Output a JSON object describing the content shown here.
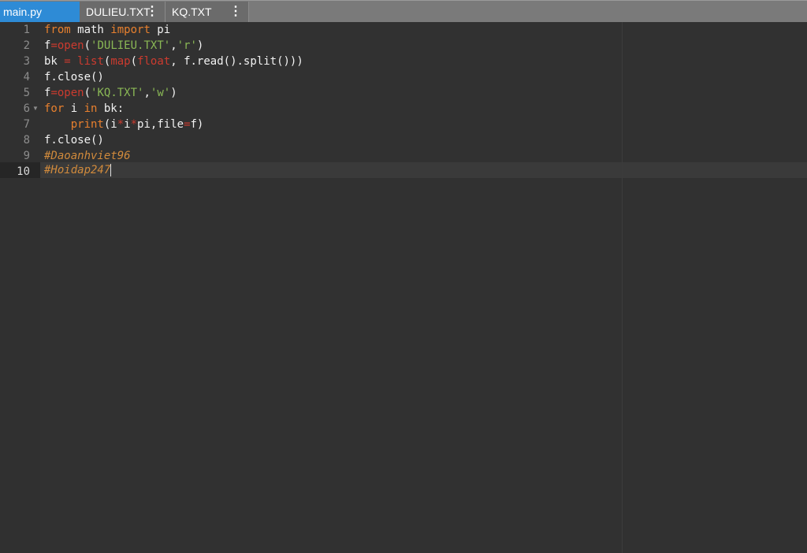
{
  "tabs": [
    {
      "label": "main.py",
      "active": true
    },
    {
      "label": "DULIEU.TXT",
      "active": false,
      "menu_icon": "kebab-menu-icon"
    },
    {
      "label": "KQ.TXT",
      "active": false,
      "menu_icon": "kebab-menu-icon"
    }
  ],
  "line_numbers": [
    "1",
    "2",
    "3",
    "4",
    "5",
    "6",
    "7",
    "8",
    "9",
    "10"
  ],
  "code": {
    "l1": {
      "t1": "from",
      "t2": " math ",
      "t3": "import",
      "t4": " pi"
    },
    "l2": {
      "t1": "f",
      "t2": "=",
      "t3": "open",
      "t4": "(",
      "t5": "'DULIEU.TXT'",
      "t6": ",",
      "t7": "'r'",
      "t8": ")"
    },
    "l3": {
      "t1": "bk ",
      "t2": "=",
      "t3": " ",
      "t4": "list",
      "t5": "(",
      "t6": "map",
      "t7": "(",
      "t8": "float",
      "t9": ", f.read().split()))"
    },
    "l4": {
      "t1": "f.close()"
    },
    "l5": {
      "t1": "f",
      "t2": "=",
      "t3": "open",
      "t4": "(",
      "t5": "'KQ.TXT'",
      "t6": ",",
      "t7": "'w'",
      "t8": ")"
    },
    "l6": {
      "t1": "for",
      "t2": " i ",
      "t3": "in",
      "t4": " bk:"
    },
    "l7": {
      "t1": "    ",
      "t2": "print",
      "t3": "(i",
      "t4": "*",
      "t5": "i",
      "t6": "*",
      "t7": "pi,file",
      "t8": "=",
      "t9": "f)"
    },
    "l8": {
      "t1": "f.close()"
    },
    "l9": {
      "t1": "#Daoanhviet96"
    },
    "l10": {
      "t1": "#Hoidap247"
    }
  },
  "colors": {
    "active_tab": "#2e8bd6",
    "keyword": "#e8802e",
    "builtin": "#cc3b2f",
    "string": "#8ab855",
    "comment": "#d08a3c",
    "background": "#303030"
  }
}
